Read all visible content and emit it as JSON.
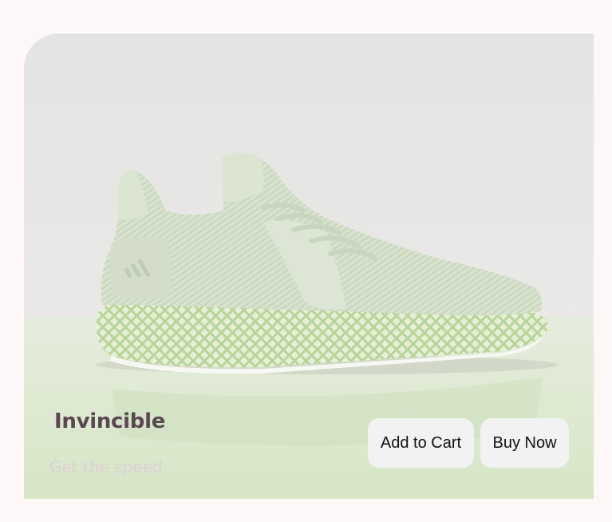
{
  "product": {
    "title": "Invincible",
    "tagline": "Get the speed",
    "brand_logo_text": "adidas",
    "image_subject": "shoe-image"
  },
  "actions": {
    "add_to_cart_label": "Add to Cart",
    "buy_now_label": "Buy Now"
  },
  "colors": {
    "page_background": "#fdf8f7",
    "title": "#5a4752",
    "tagline": "#e0cfd8",
    "button_background": "#f2f2f2",
    "shoe": "#d9e4cf",
    "sole": "#c5e0a8"
  }
}
